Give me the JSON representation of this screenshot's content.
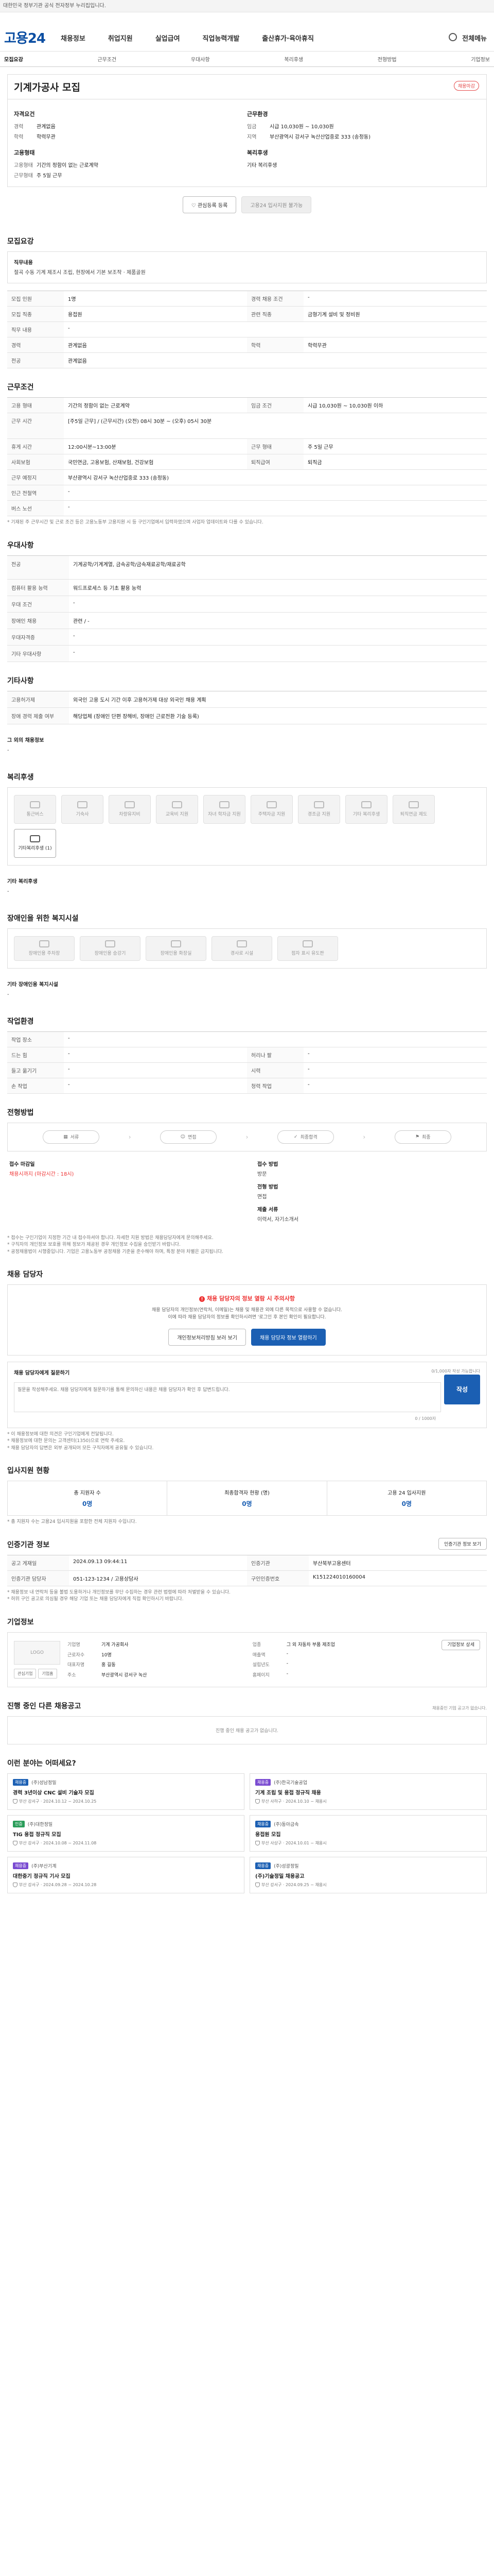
{
  "topbar": {
    "text": "대한민국 정부기관 공식 전자정부 누리집입니다."
  },
  "logo": "고용24",
  "menu": [
    "채용정보",
    "취업지원",
    "실업급여",
    "직업능력개발",
    "출산휴가·육아휴직"
  ],
  "menu_right": "전체메뉴",
  "tabs": [
    {
      "label": "모집요강",
      "active": true
    },
    {
      "label": "근무조건",
      "active": false
    },
    {
      "label": "우대사항",
      "active": false
    },
    {
      "label": "복리후생",
      "active": false
    },
    {
      "label": "전형방법",
      "active": false
    },
    {
      "label": "기업정보",
      "active": false
    }
  ],
  "header": {
    "title": "기계가공사 모집",
    "chip": "채용마감",
    "col1": {
      "title": "자격요건",
      "rows": [
        {
          "k": "경력",
          "v": "관계없음"
        },
        {
          "k": "학력",
          "v": "학력무관"
        }
      ]
    },
    "col2": {
      "title": "근무환경",
      "rows": [
        {
          "k": "임금",
          "v": "시급 10,030원 ~ 10,030원"
        },
        {
          "k": "지역",
          "v": "부산광역시 강서구 녹산산업중로 333 (송정동)"
        }
      ]
    },
    "col3": {
      "title": "고용형태",
      "rows": [
        {
          "k": "고용형태",
          "v": "기간의 정함이 없는 근로계약"
        },
        {
          "k": "근무형태",
          "v": "주 5일 근무"
        }
      ]
    },
    "col4": {
      "title": "복리후생",
      "rows": [
        {
          "k": "",
          "v": "기타 복리후생"
        }
      ]
    },
    "btn_interest": "관심등록 등록",
    "btn_apply": "고용24 입사지원 불가능"
  },
  "recruit": {
    "section_title": "모집요강",
    "job_title": "직무내용",
    "job_desc": "절곡 수동 기계 제조시 조립, 현장에서 기본 보조작 · 제품골원",
    "rows": [
      [
        "모집 인원",
        "1명",
        "경력 채용 조건",
        "-"
      ],
      [
        "모집 직종",
        "용접원",
        "관련 직종",
        "금형기계 설비 및 정비원"
      ],
      [
        "직무 내용",
        "-",
        "",
        ""
      ],
      [
        "경력",
        "관계없음",
        "학력",
        "학력무관"
      ],
      [
        "전공",
        "관계없음",
        "",
        ""
      ]
    ]
  },
  "conditions": {
    "section_title": "근무조건",
    "rows": [
      [
        "고용 형태",
        "기간의 정함이 없는 근로계약",
        "임금 조건",
        "시급 10,030원 ~ 10,030원 이하"
      ],
      [
        "근무 시간",
        "[주5일 근무] / (근무시간) (오전) 08시 30분 ~ (오후) 05시 30분",
        "",
        ""
      ],
      [
        "휴게 시간",
        "12:00시분~13:00분",
        "근무 형태",
        "주 5일 근무"
      ],
      [
        "사회보험",
        "국민연금, 고용보험, 산재보험, 건강보험",
        "퇴직급여",
        "퇴직금"
      ],
      [
        "근무 예정지",
        "부산광역시 강서구 녹산산업중로 333 (송정동)",
        "",
        ""
      ],
      [
        "인근 전철역",
        "-",
        "",
        ""
      ],
      [
        "버스 노선",
        "-",
        "",
        ""
      ]
    ],
    "note": "* 기재된 주 근무시간 및 근로 조건 등은 고용노동부 고용지원 시 등 구인기업에서 입력하였으며 사업자 업데이트와 다를 수 있습니다."
  },
  "preferences": {
    "section_title": "우대사항",
    "rows": [
      [
        "전공",
        "기계공학/기계계열, 금속공학/금속재료공학/재료공학"
      ],
      [
        "컴퓨터 활용 능력",
        "워드프로세스 등 기초 활용 능력"
      ],
      [
        "우대 조건",
        "-"
      ],
      [
        "장애인 채용",
        "관련 / -"
      ],
      [
        "우대자격증",
        "-"
      ],
      [
        "기타 우대사항",
        "-"
      ]
    ]
  },
  "extra": {
    "section_title": "기타사항",
    "rows": [
      [
        "고용허가제",
        "외국인 고용 도시 기간 이후 고용허가제 대상 외국인 채용 계획"
      ],
      [
        "장애 경력 제출 여부",
        "해당업체 (장애인 단편 장해비, 장애인 근로전환 기술 등록)"
      ]
    ],
    "more_title": "그 외의 채용정보",
    "more_val": "-"
  },
  "welfare": {
    "section_title": "복리후생",
    "tiles": [
      {
        "label": "통근버스",
        "on": false
      },
      {
        "label": "기숙사",
        "on": false
      },
      {
        "label": "차량유지비",
        "on": false
      },
      {
        "label": "교육비 지원",
        "on": false
      },
      {
        "label": "자녀 학자금 지원",
        "on": false
      },
      {
        "label": "주택자금 지원",
        "on": false
      },
      {
        "label": "경조금 지원",
        "on": false
      },
      {
        "label": "기타 복리후생",
        "on": false
      },
      {
        "label": "퇴직연금 제도",
        "on": false
      },
      {
        "label": "기타복리후생 (1)",
        "on": true
      }
    ],
    "etc_title": "기타 복리후생",
    "etc_val": "-"
  },
  "disability": {
    "section_title": "장애인을 위한 복지시설",
    "tiles": [
      "장애인용 주차장",
      "장애인용 승강기",
      "장애인용 화장실",
      "경사로 시설",
      "점자 표시 유도판"
    ],
    "etc_title": "기타 장애인용 복지시설",
    "etc_val": "-"
  },
  "environment": {
    "section_title": "작업환경",
    "rows": [
      [
        "작업 장소",
        "-",
        "",
        ""
      ],
      [
        "드는 힘",
        "-",
        "허리나 팔",
        "-"
      ],
      [
        "들고 옮기기",
        "-",
        "시력",
        "-"
      ],
      [
        "손 작업",
        "-",
        "청력 작업",
        "-"
      ]
    ]
  },
  "process": {
    "section_title": "전형방법",
    "steps": [
      "서류",
      "면접",
      "최종합격",
      "최종"
    ],
    "left_title": "접수 마감일",
    "left_val": "채용시까지 (마감시간 : 18시)",
    "right": [
      {
        "k": "접수 방법",
        "v": "방문"
      },
      {
        "k": "전형 방법",
        "v": "면접"
      },
      {
        "k": "제출 서류",
        "v": "이력서, 자기소개서"
      }
    ],
    "notes": [
      "* 접수는 구인기업이 지정한 기간 내 접수하셔야 합니다. 자세한 지원 방법은 채용담당자에게 문의해주세요.",
      "* 구직자의 개인정보 보호를 위해 정보가 제공된 경우 개인정보 수집을 승인받기 바랍니다.",
      "* 공정채용법이 시행중입니다. 기업은 고용노동부 공정채용 기준을 준수해야 하며, 특정 분야 차별은 금지됩니다."
    ]
  },
  "contact": {
    "section_title": "채용 담당자",
    "warn": "채용 담당자의 정보 열람 시 주의사항",
    "desc1": "채용 담당자의 개인정보(연락처, 이메일)는 채용 및 채용관 외에 다른 목적으로 사용할 수 없습니다.",
    "desc2": "이에 따라 채용 담당자의 정보를 확인하시려면 '로그인 후 본인 확인이 필요합니다.",
    "btn1": "개인정보처리방침 보러 보기",
    "btn2": "채용 담당자 정보 열람하기",
    "ask_title": "채용 담당자에게 질문하기",
    "ask_right": "0/1,000자 작성 가능합니다",
    "ask_placeholder": "질문을 작성해주세요. 채용 담당자에게 질문하기를 통해 문의하신 내용은 채용 담당자가 확인 후 답변드립니다.",
    "ask_btn": "작성",
    "counter": "0 / 1000자",
    "notes": [
      "* 이 채용정보에 대한 의견은 구인기업에게 전달됩니다.",
      "* 채용정보에 대한 문의는 고객센터(1350)으로 연락 주세요.",
      "* 채용 담당자의 답변은 외부 공개되어 모든 구직자에게 공유될 수 있습니다."
    ]
  },
  "status": {
    "section_title": "입사지원 현황",
    "items": [
      {
        "label": "총 지원자 수",
        "val": "0명"
      },
      {
        "label": "최종합격자 현황 (명)",
        "val": "0명"
      },
      {
        "label": "고용 24 입사지원",
        "val": "0명"
      }
    ],
    "note": "* 총 지원자 수는 고용24 입사지원을 포함한 전체 지원자 수입니다."
  },
  "org": {
    "section_title": "인증기관 정보",
    "btn": "인증기관 정보 보기",
    "rows": [
      [
        "공고 게재일",
        "2024.09.13 09:44:11",
        "인증기관",
        "부산북부고용센터"
      ],
      [
        "인증기관 담당자",
        "051-123-1234 / 고용상담사",
        "구인인증번호",
        "K151224010160004"
      ]
    ],
    "notes": [
      "* 채용정보 내 연락처 등을 불법 도용하거나 개인정보를 무단 수집하는 경우 관련 법령에 따라 처벌받을 수 있습니다.",
      "* 허위 구인 공고로 의심될 경우 해당 기업 또는 채용 담당자에게 직접 확인하시기 바랍니다."
    ]
  },
  "company": {
    "section_title": "기업정보",
    "logo": "LOGO",
    "btn1": "관심기업",
    "btn2": "기업홈",
    "btn_detail": "기업정보 상세",
    "info": [
      {
        "k": "기업명",
        "v": "기계 가공회사"
      },
      {
        "k": "업종",
        "v": "그 외 자동차 부품 제조업"
      },
      {
        "k": "근로자수",
        "v": "10명"
      },
      {
        "k": "매출액",
        "v": "-"
      },
      {
        "k": "대표자명",
        "v": "홍 길동"
      },
      {
        "k": "설립년도",
        "v": "-"
      },
      {
        "k": "주소",
        "v": "부산광역시 강서구 녹산"
      },
      {
        "k": "홈페이지",
        "v": "-"
      }
    ]
  },
  "other_jobs": {
    "section_title": "진행 중인 다른 채용공고",
    "right": "채용중인 기업 공고가 없습니다.",
    "empty": "진행 중인 채용 공고가 없습니다."
  },
  "recommend": {
    "section_title": "이런 분야는 어떠세요?",
    "cards": [
      {
        "badge": "채용중",
        "co": "(주)성남정밀",
        "title": "경력 3년이상 CNC 설비 기술자 모집",
        "meta": "부산 강서구 · 2024.10.12 ~ 2024.10.25"
      },
      {
        "badge": "채용중",
        "co": "(주)한국기술공업",
        "title": "기계 조립 및 용접 정규직 채용",
        "meta": "부산 사하구 · 2024.10.10 ~ 채용시"
      },
      {
        "badge": "인증",
        "co": "(주)대한정밀",
        "title": "TIG 용접 정규직 모집",
        "meta": "부산 강서구 · 2024.10.08 ~ 2024.11.08"
      },
      {
        "badge": "채용중",
        "co": "(주)동아금속",
        "title": "용접원 모집",
        "meta": "부산 사상구 · 2024.10.01 ~ 채용시"
      },
      {
        "badge": "채용중",
        "co": "(주)부산기계",
        "title": "대한중기 정규직 기사 모집",
        "meta": "부산 강서구 · 2024.09.28 ~ 2024.10.28"
      },
      {
        "badge": "채용중",
        "co": "(주)성광정밀",
        "title": "(주)기술정밀 채용공고",
        "meta": "부산 강서구 · 2024.09.25 ~ 채용시"
      }
    ]
  }
}
